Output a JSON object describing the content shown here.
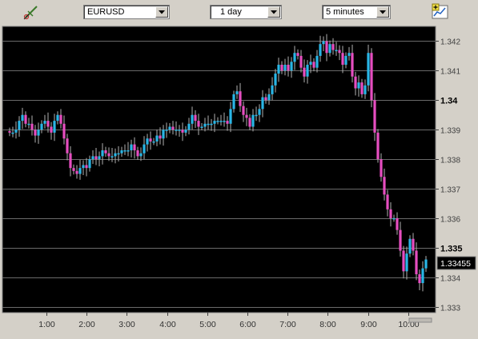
{
  "toolbar": {
    "symbol": "EURUSD",
    "range": "1 day",
    "interval": "5 minutes"
  },
  "chart_data": {
    "type": "candlestick",
    "symbol": "EURUSD",
    "y_ticks": [
      "1.342",
      "1.341",
      "1.34",
      "1.339",
      "1.338",
      "1.337",
      "1.336",
      "1.335",
      "1.334",
      "1.333"
    ],
    "y_tick_values": [
      1.342,
      1.341,
      1.34,
      1.339,
      1.338,
      1.337,
      1.336,
      1.335,
      1.334,
      1.333
    ],
    "bold_ticks": [
      "1.34",
      "1.335"
    ],
    "x_ticks": [
      "1:00",
      "2:00",
      "3:00",
      "4:00",
      "5:00",
      "6:00",
      "7:00",
      "8:00",
      "9:00",
      "10:00"
    ],
    "ylim": [
      1.3328,
      1.3425
    ],
    "current_price": "1.33455",
    "grid": true,
    "colors": {
      "up": "#29b6e6",
      "down": "#e64ec0",
      "wick": "#b0b0b0",
      "background": "#000000"
    },
    "closes": [
      1.3389,
      1.3389,
      1.339,
      1.3393,
      1.3395,
      1.3392,
      1.3392,
      1.339,
      1.3388,
      1.339,
      1.3392,
      1.3393,
      1.3391,
      1.3389,
      1.3393,
      1.3395,
      1.3392,
      1.3387,
      1.3382,
      1.3377,
      1.3376,
      1.3375,
      1.3377,
      1.3378,
      1.3377,
      1.338,
      1.3381,
      1.338,
      1.3381,
      1.3383,
      1.3382,
      1.3381,
      1.3381,
      1.3382,
      1.3382,
      1.3383,
      1.3383,
      1.3383,
      1.3385,
      1.3383,
      1.3381,
      1.3382,
      1.3385,
      1.3387,
      1.3386,
      1.3386,
      1.3388,
      1.3387,
      1.339,
      1.339,
      1.3391,
      1.339,
      1.339,
      1.339,
      1.3389,
      1.339,
      1.3392,
      1.3395,
      1.3393,
      1.3391,
      1.3391,
      1.3392,
      1.3392,
      1.3392,
      1.3393,
      1.3393,
      1.3393,
      1.3393,
      1.3392,
      1.3397,
      1.3402,
      1.3403,
      1.3398,
      1.3395,
      1.3394,
      1.3391,
      1.3395,
      1.3395,
      1.3397,
      1.3401,
      1.34,
      1.3402,
      1.3405,
      1.3409,
      1.3412,
      1.341,
      1.3412,
      1.341,
      1.3413,
      1.3416,
      1.3415,
      1.3411,
      1.3408,
      1.3412,
      1.3413,
      1.3411,
      1.3415,
      1.3419,
      1.342,
      1.3416,
      1.3419,
      1.3417,
      1.3417,
      1.3416,
      1.3412,
      1.3415,
      1.3416,
      1.3408,
      1.3404,
      1.3406,
      1.3402,
      1.3405,
      1.3416,
      1.34,
      1.3389,
      1.338,
      1.3374,
      1.3368,
      1.3363,
      1.336,
      1.336,
      1.3356,
      1.3349,
      1.3342,
      1.3348,
      1.3353,
      1.3349,
      1.3341,
      1.3338,
      1.3343,
      1.3346
    ]
  }
}
